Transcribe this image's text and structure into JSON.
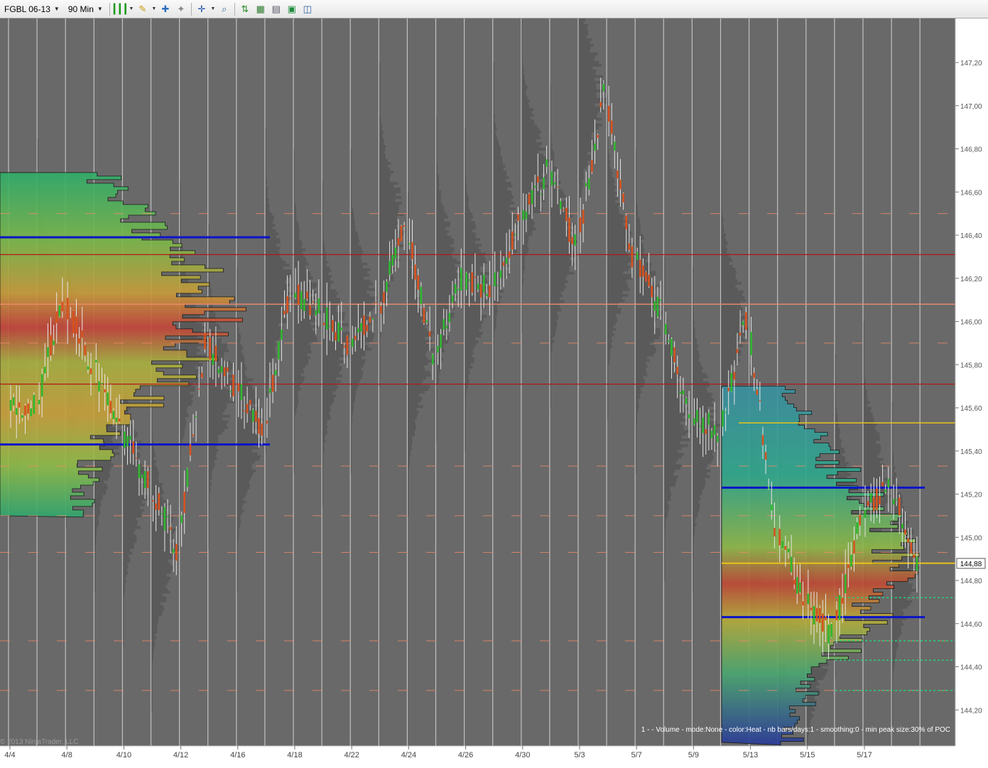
{
  "toolbar": {
    "instrument": "FGBL 06-13",
    "interval": "90 Min",
    "icons": [
      "bar-type-icon",
      "drawing-pencil-icon",
      "add-indicator-icon",
      "strategy-icon",
      "crosshair-icon",
      "zoom-icon",
      "chart-trader-icon",
      "data-box-icon",
      "properties-icon",
      "save-icon",
      "panel-icon"
    ]
  },
  "colors": {
    "background": "#696969",
    "profile_shade": "#585858",
    "separator": "#d8d8d8",
    "up_bar": "#2fb82f",
    "down_bar": "#d8521e",
    "value_area_line": "#0a14c8",
    "poc_line": "#b01818",
    "naked_poc": "#f08a6a",
    "current_price": "#e8c31a",
    "target_line": "#26d07a"
  },
  "chart_data": {
    "type": "candlestick-volume-profile",
    "instrument": "FGBL 06-13",
    "interval": "90 Min",
    "y_axis": {
      "ticks": [
        "147,20",
        "147,00",
        "146,80",
        "146,60",
        "146,40",
        "146,20",
        "146,00",
        "145,80",
        "145,60",
        "145,40",
        "145,20",
        "145,00",
        "144,80",
        "144,60",
        "144,40",
        "144,20"
      ],
      "range": [
        144.1,
        147.4
      ]
    },
    "x_axis": {
      "ticks": [
        "4/4",
        "4/8",
        "4/10",
        "4/12",
        "4/16",
        "4/18",
        "4/22",
        "4/24",
        "4/26",
        "4/30",
        "5/3",
        "5/7",
        "5/9",
        "5/13",
        "5/15",
        "5/17"
      ]
    },
    "current_price": 144.88,
    "current_price_label": "144,88",
    "price_path": [
      {
        "day": 0,
        "price": 145.6
      },
      {
        "day": 1,
        "price": 146.1
      },
      {
        "day": 2,
        "price": 145.8
      },
      {
        "day": 3,
        "price": 145.5
      },
      {
        "day": 4,
        "price": 145.25
      },
      {
        "day": 5,
        "price": 144.95
      },
      {
        "day": 6,
        "price": 145.9
      },
      {
        "day": 7,
        "price": 145.7
      },
      {
        "day": 8,
        "price": 145.5
      },
      {
        "day": 9,
        "price": 146.15
      },
      {
        "day": 10,
        "price": 146.05
      },
      {
        "day": 11,
        "price": 145.9
      },
      {
        "day": 12,
        "price": 146.05
      },
      {
        "day": 13,
        "price": 146.45
      },
      {
        "day": 14,
        "price": 145.85
      },
      {
        "day": 15,
        "price": 146.2
      },
      {
        "day": 16,
        "price": 146.15
      },
      {
        "day": 17,
        "price": 146.45
      },
      {
        "day": 18,
        "price": 146.7
      },
      {
        "day": 19,
        "price": 146.35
      },
      {
        "day": 20,
        "price": 147.05
      },
      {
        "day": 21,
        "price": 146.3
      },
      {
        "day": 22,
        "price": 146.05
      },
      {
        "day": 23,
        "price": 145.55
      },
      {
        "day": 24,
        "price": 145.5
      },
      {
        "day": 25,
        "price": 146.0
      },
      {
        "day": 26,
        "price": 145.05
      },
      {
        "day": 27,
        "price": 144.7
      },
      {
        "day": 28,
        "price": 144.55
      },
      {
        "day": 29,
        "price": 145.1
      },
      {
        "day": 30,
        "price": 145.25
      },
      {
        "day": 31,
        "price": 144.88
      }
    ],
    "profile_levels": {
      "value_area_high_1": 146.39,
      "value_area_low_1": 145.43,
      "poc_lines_1": [
        146.31,
        146.08,
        145.71
      ],
      "value_area_high_2": 145.23,
      "value_area_low_2": 144.63,
      "poc_2": 145.53,
      "naked_pocs": [
        146.5,
        145.9,
        145.33,
        145.1,
        144.93,
        144.52,
        144.29
      ],
      "targets": [
        144.72,
        144.52,
        144.43,
        144.29
      ]
    },
    "annotation": "1 -  - Volume - mode:None - color:Heat - nb bars/days:1 - smoothing:0 - min peak size:30% of POC",
    "copyright": "© 2013 NinjaTrader, LLC"
  }
}
